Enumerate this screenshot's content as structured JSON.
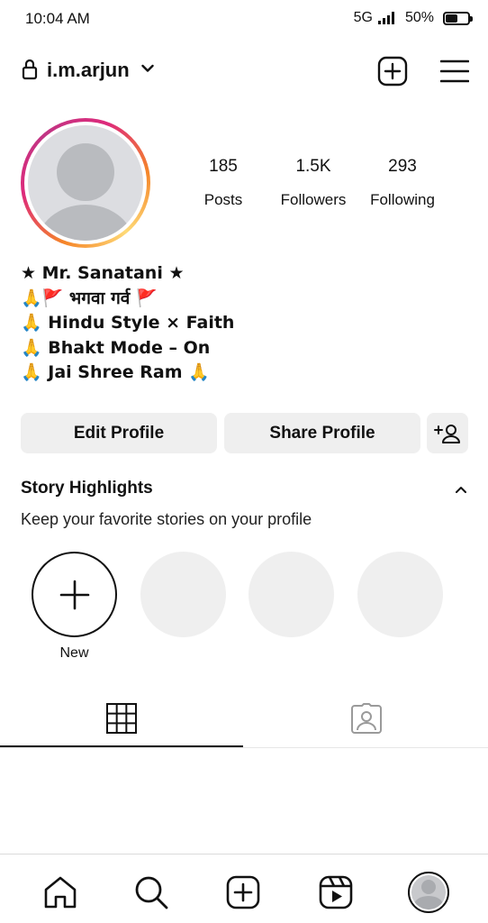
{
  "status_bar": {
    "time": "10:04 AM",
    "network": "5G",
    "battery": "50%",
    "battery_level": 0.5
  },
  "header": {
    "username": "i.m.arjun"
  },
  "profile": {
    "stats": [
      {
        "value": "185",
        "label": "Posts"
      },
      {
        "value": "1.5K",
        "label": "Followers"
      },
      {
        "value": "293",
        "label": "Following"
      }
    ],
    "bio": [
      "★ Mr. Sanatani ★",
      "🙏🚩 भगवा गर्व 🚩",
      "🙏 Hindu Style × Faith",
      "🙏 Bhakt Mode – On",
      "🙏 Jai Shree Ram 🙏"
    ]
  },
  "actions": {
    "edit_profile": "Edit Profile",
    "share_profile": "Share Profile"
  },
  "highlights": {
    "title": "Story Highlights",
    "subtitle": "Keep your favorite stories on your profile",
    "new_label": "New"
  },
  "icons": {
    "lock": "lock-icon",
    "chevron_down": "chevron-down-icon",
    "add_post": "plus-square-icon",
    "menu": "hamburger-icon",
    "add_user": "add-user-icon",
    "chevron_up": "chevron-up-icon",
    "grid": "grid-icon",
    "tagged": "tagged-person-icon",
    "home": "home-icon",
    "search": "search-icon",
    "create": "plus-square-icon",
    "reels": "reels-icon",
    "profile": "avatar"
  },
  "colors": {
    "ring_gradient": [
      "#f58529",
      "#dd2a7b",
      "#c13584"
    ],
    "button_bg": "#efefef",
    "text": "#111111"
  }
}
